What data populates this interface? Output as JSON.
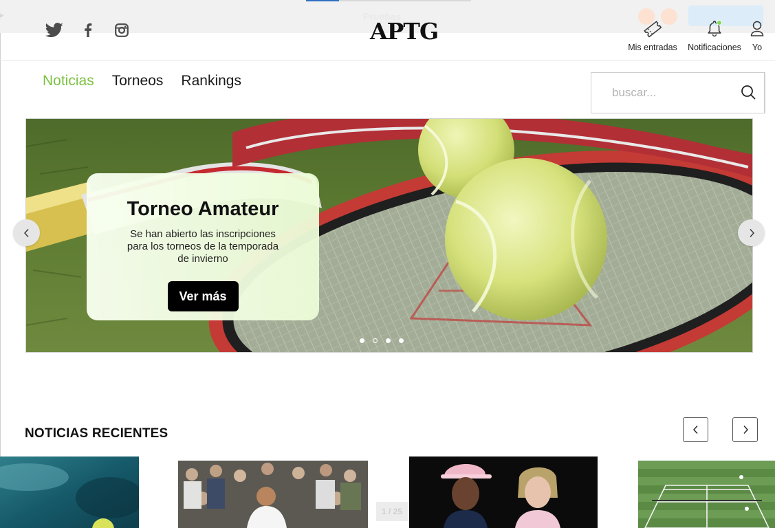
{
  "overlay": {
    "label": "Pruebas",
    "counter": "1 / 25",
    "progress": 0.2
  },
  "header": {
    "logo": "APTG",
    "social": [
      "twitter-icon",
      "facebook-icon",
      "instagram-icon"
    ],
    "actions": [
      {
        "label": "Mis entradas",
        "icon": "ticket-icon"
      },
      {
        "label": "Notificaciones",
        "icon": "bell-icon",
        "has_unread": true
      },
      {
        "label": "Yo",
        "icon": "user-icon"
      }
    ]
  },
  "nav": {
    "items": [
      {
        "label": "Noticias",
        "active": true
      },
      {
        "label": "Torneos",
        "active": false
      },
      {
        "label": "Rankings",
        "active": false
      }
    ]
  },
  "search": {
    "placeholder": "buscar...",
    "value": ""
  },
  "hero": {
    "title": "Torneo Amateur",
    "description": "Se han abierto las inscripciones para los torneos de la temporada de invierno",
    "cta": "Ver más",
    "slide_count": 4,
    "active_slide": 2
  },
  "recent_news": {
    "title": "NOTICIAS RECIENTES"
  },
  "colors": {
    "accent": "#7cc242",
    "notification_dot": "#7ed957",
    "cta_bg": "#000000"
  }
}
